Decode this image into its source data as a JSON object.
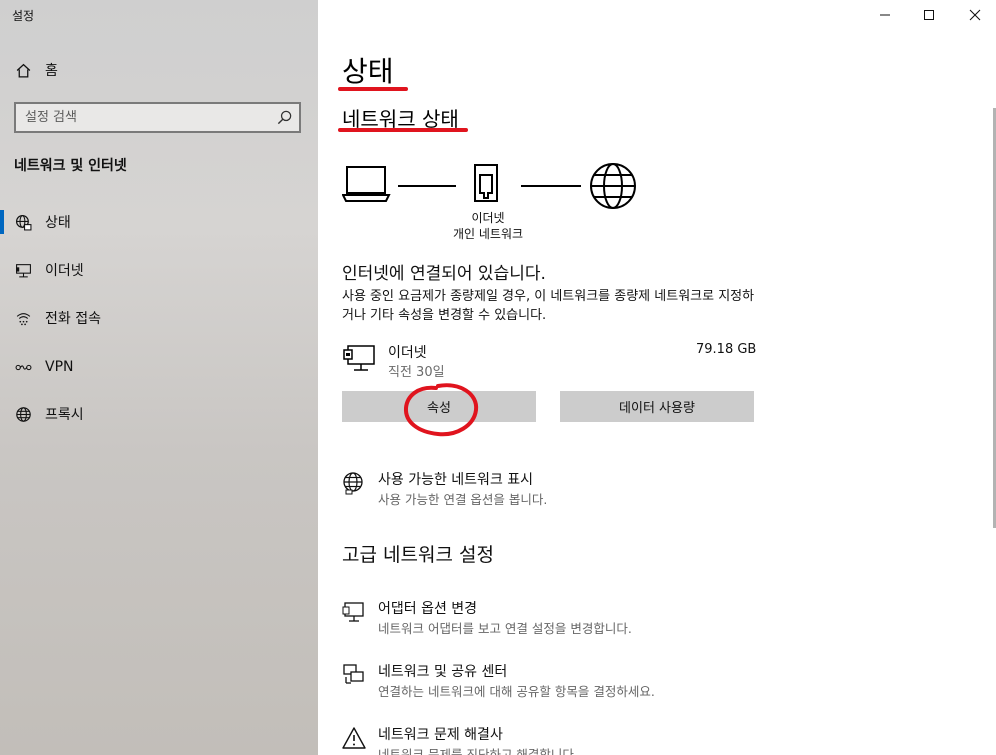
{
  "app": {
    "title": "설정"
  },
  "sidebar": {
    "home_label": "홈",
    "search_placeholder": "설정 검색",
    "section_title": "네트워크 및 인터넷",
    "items": [
      {
        "label": "상태",
        "icon": "globe-status-icon",
        "active": true
      },
      {
        "label": "이더넷",
        "icon": "ethernet-icon",
        "active": false
      },
      {
        "label": "전화 접속",
        "icon": "dialup-icon",
        "active": false
      },
      {
        "label": "VPN",
        "icon": "vpn-icon",
        "active": false
      },
      {
        "label": "프록시",
        "icon": "globe-icon",
        "active": false
      }
    ]
  },
  "window_controls": [
    "minimize",
    "maximize",
    "close"
  ],
  "main": {
    "page_title": "상태",
    "network_status_title": "네트워크 상태",
    "diagram": {
      "adapter_label": "이더넷",
      "network_label": "개인 네트워크"
    },
    "status_heading": "인터넷에 연결되어 있습니다.",
    "status_desc": "사용 중인 요금제가 종량제일 경우, 이 네트워크를 종량제 네트워크로 지정하거나 기타 속성을 변경할 수 있습니다.",
    "connection": {
      "name": "이더넷",
      "period": "직전 30일",
      "usage": "79.18 GB"
    },
    "buttons": {
      "properties": "속성",
      "data_usage": "데이터 사용량"
    },
    "show_networks": {
      "title": "사용 가능한 네트워크 표시",
      "desc": "사용 가능한 연결 옵션을 봅니다."
    },
    "advanced_heading": "고급 네트워크 설정",
    "advanced_items": [
      {
        "title": "어댑터 옵션 변경",
        "desc": "네트워크 어댑터를 보고 연결 설정을 변경합니다.",
        "icon": "monitor-icon"
      },
      {
        "title": "네트워크 및 공유 센터",
        "desc": "연결하는 네트워크에 대해 공유할 항목을 결정하세요.",
        "icon": "sharing-center-icon"
      },
      {
        "title": "네트워크 문제 해결사",
        "desc": "네트워크 문제를 진단하고 해결합니다.",
        "icon": "warning-icon"
      }
    ]
  },
  "colors": {
    "annotation_red": "#e0141e",
    "button_gray": "#cccccc",
    "accent": "#0067c0"
  }
}
